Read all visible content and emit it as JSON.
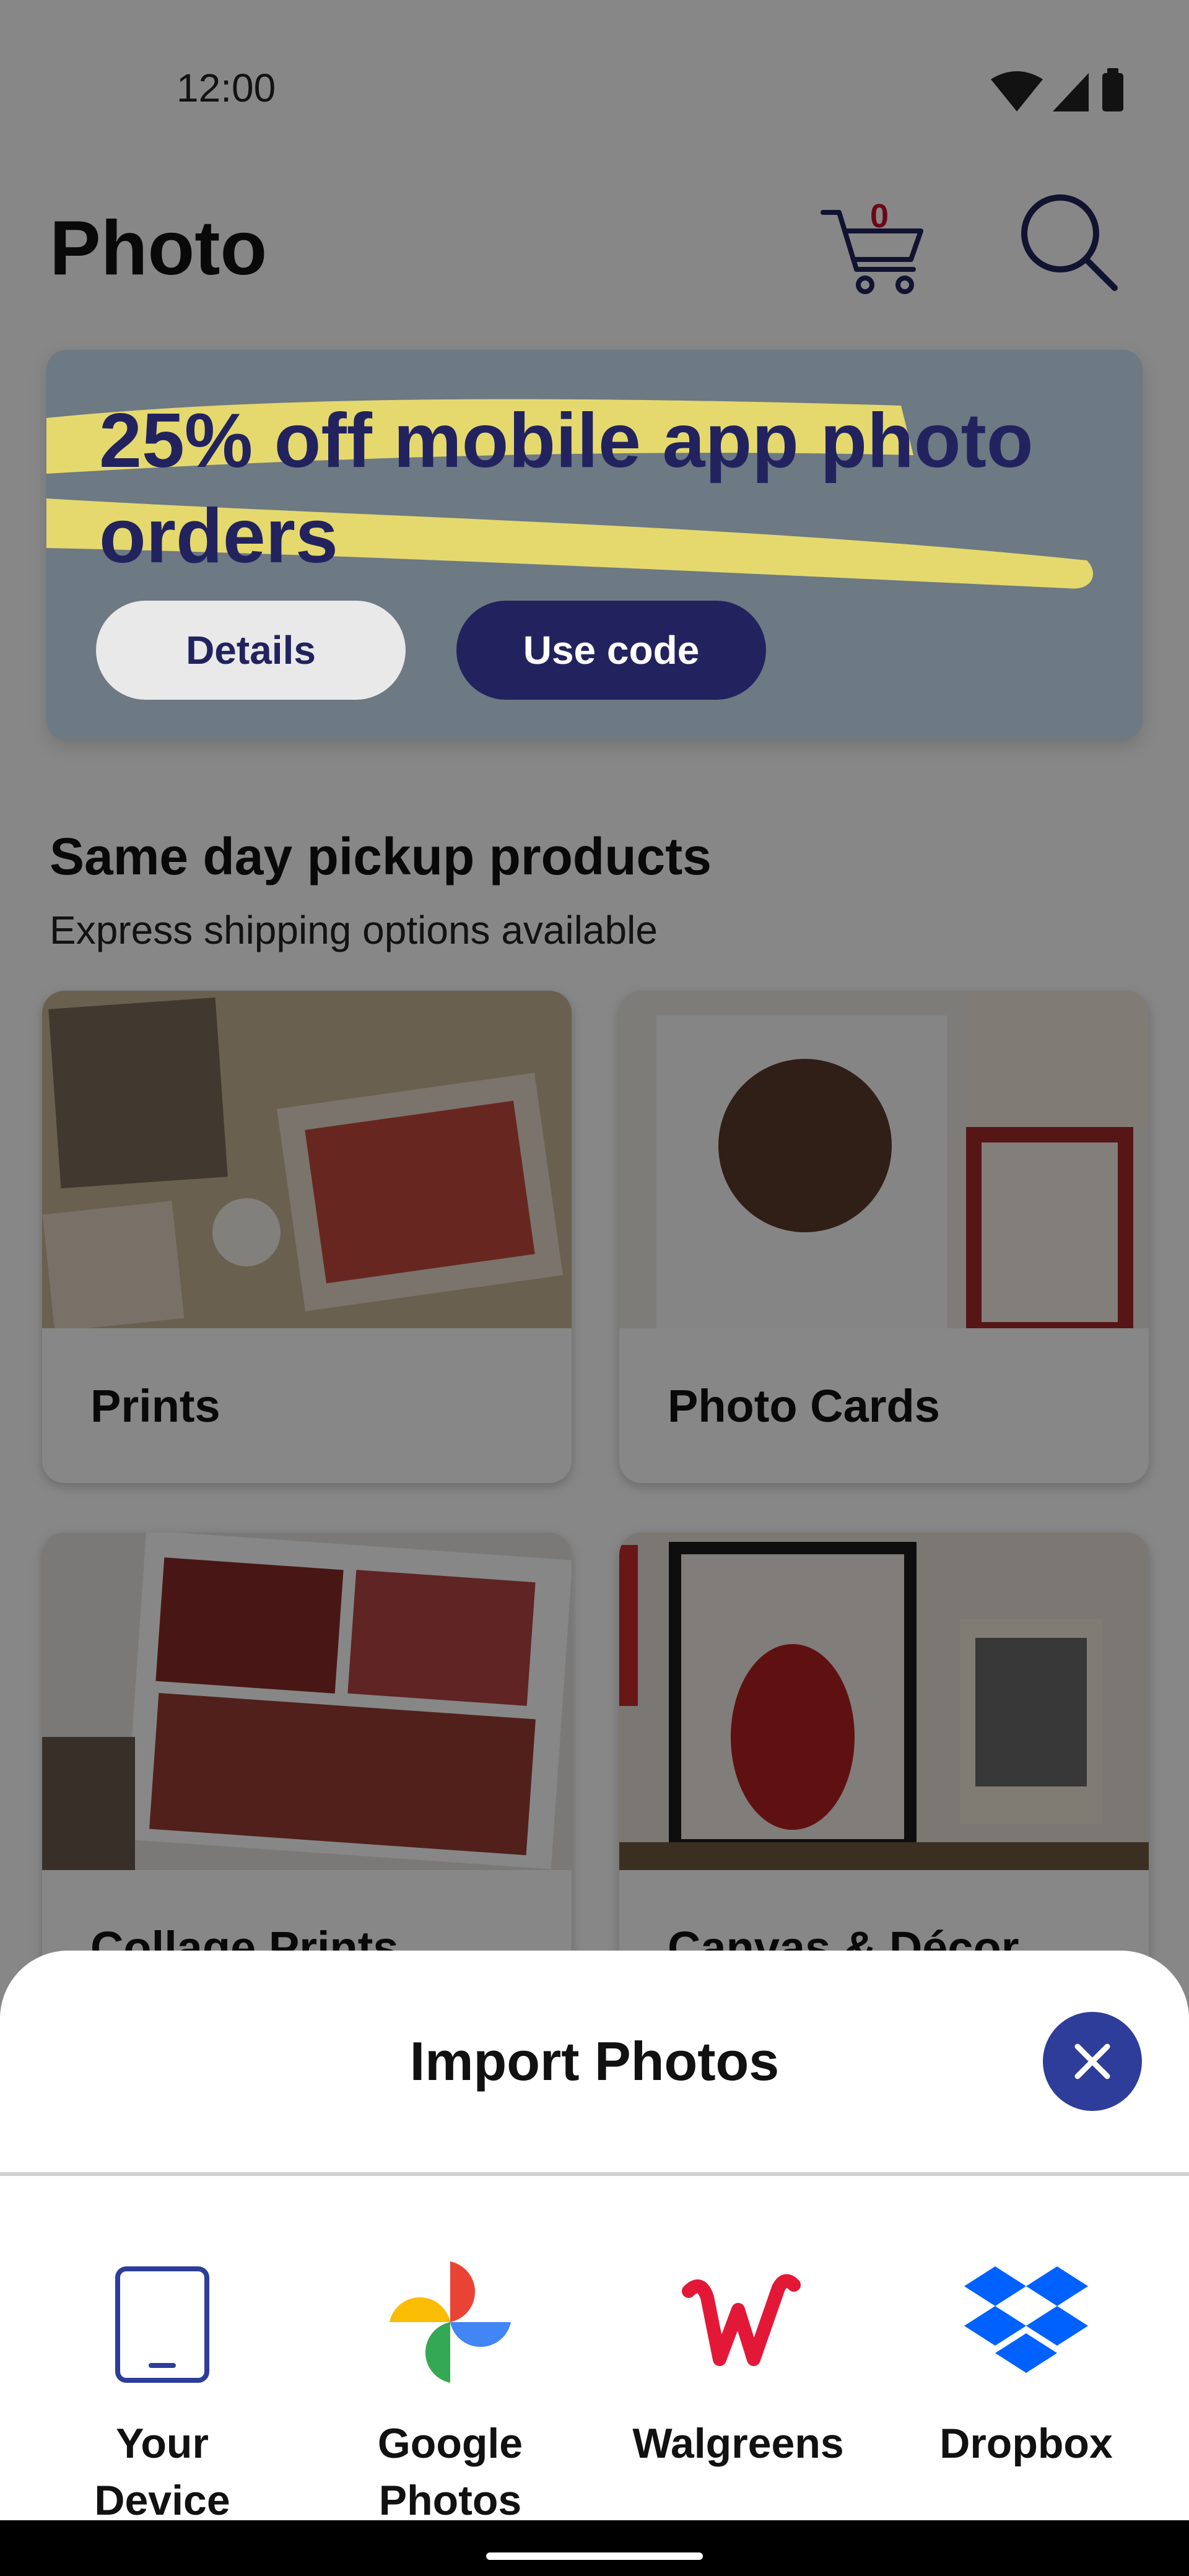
{
  "status_bar": {
    "time": "12:00",
    "icons": [
      "wifi-icon",
      "signal-icon",
      "battery-icon"
    ]
  },
  "header": {
    "title": "Photo",
    "cart_count": "0",
    "icons": [
      "cart-icon",
      "search-icon"
    ]
  },
  "promo": {
    "title": "25% off mobile app photo orders",
    "details_label": "Details",
    "use_code_label": "Use code"
  },
  "section": {
    "title": "Same day pickup products",
    "subtitle": "Express shipping options available"
  },
  "products": [
    {
      "label": "Prints"
    },
    {
      "label": "Photo Cards"
    },
    {
      "label": "Collage Prints"
    },
    {
      "label": "Canvas & Décor"
    }
  ],
  "import_sheet": {
    "title": "Import Photos",
    "options": [
      {
        "label": "Your\nDevice",
        "icon": "device-icon"
      },
      {
        "label": "Google\nPhotos",
        "icon": "google-photos-icon"
      },
      {
        "label": "Walgreens",
        "icon": "walgreens-icon"
      },
      {
        "label": "Dropbox",
        "icon": "dropbox-icon"
      }
    ]
  },
  "colors": {
    "brand_navy": "#22235e",
    "close_button": "#2d3d99",
    "walgreens_red": "#e31837",
    "dropbox_blue": "#0061fe",
    "cart_count": "#c8102e"
  }
}
